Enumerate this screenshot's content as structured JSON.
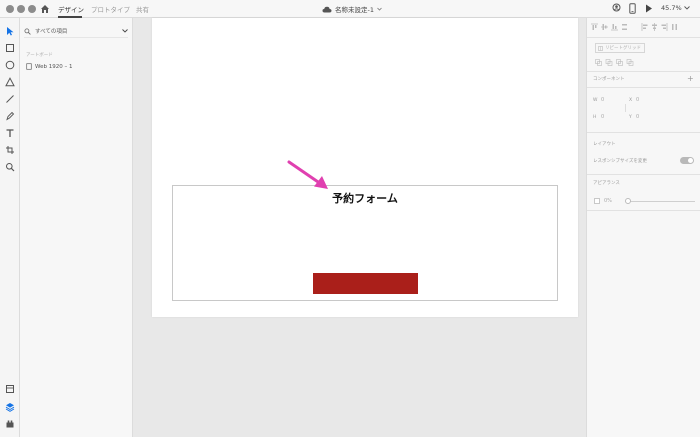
{
  "titlebar": {
    "tabs": [
      {
        "label": "デザイン",
        "active": true
      },
      {
        "label": "プロトタイプ",
        "active": false
      },
      {
        "label": "共有",
        "active": false
      }
    ],
    "doc_title": "名称未設定-1",
    "zoom": "45.7%"
  },
  "layers": {
    "search_placeholder": "すべての項目",
    "section_label": "アートボード",
    "items": [
      {
        "label": "Web 1920 – 1"
      }
    ]
  },
  "canvas": {
    "form_title": "予約フォーム",
    "button_color": "#aa1f1a",
    "arrow_color": "#e040b0"
  },
  "props": {
    "repeat_grid": "リピートグリッド",
    "components": "コンポーネント",
    "w_label": "W",
    "w_value": "0",
    "x_label": "X",
    "x_value": "0",
    "h_label": "H",
    "h_value": "0",
    "y_label": "Y",
    "y_value": "0",
    "layout": "レイアウト",
    "responsive": "レスポンシブサイズを変更",
    "appearance": "アピアランス",
    "opacity": "0%"
  }
}
